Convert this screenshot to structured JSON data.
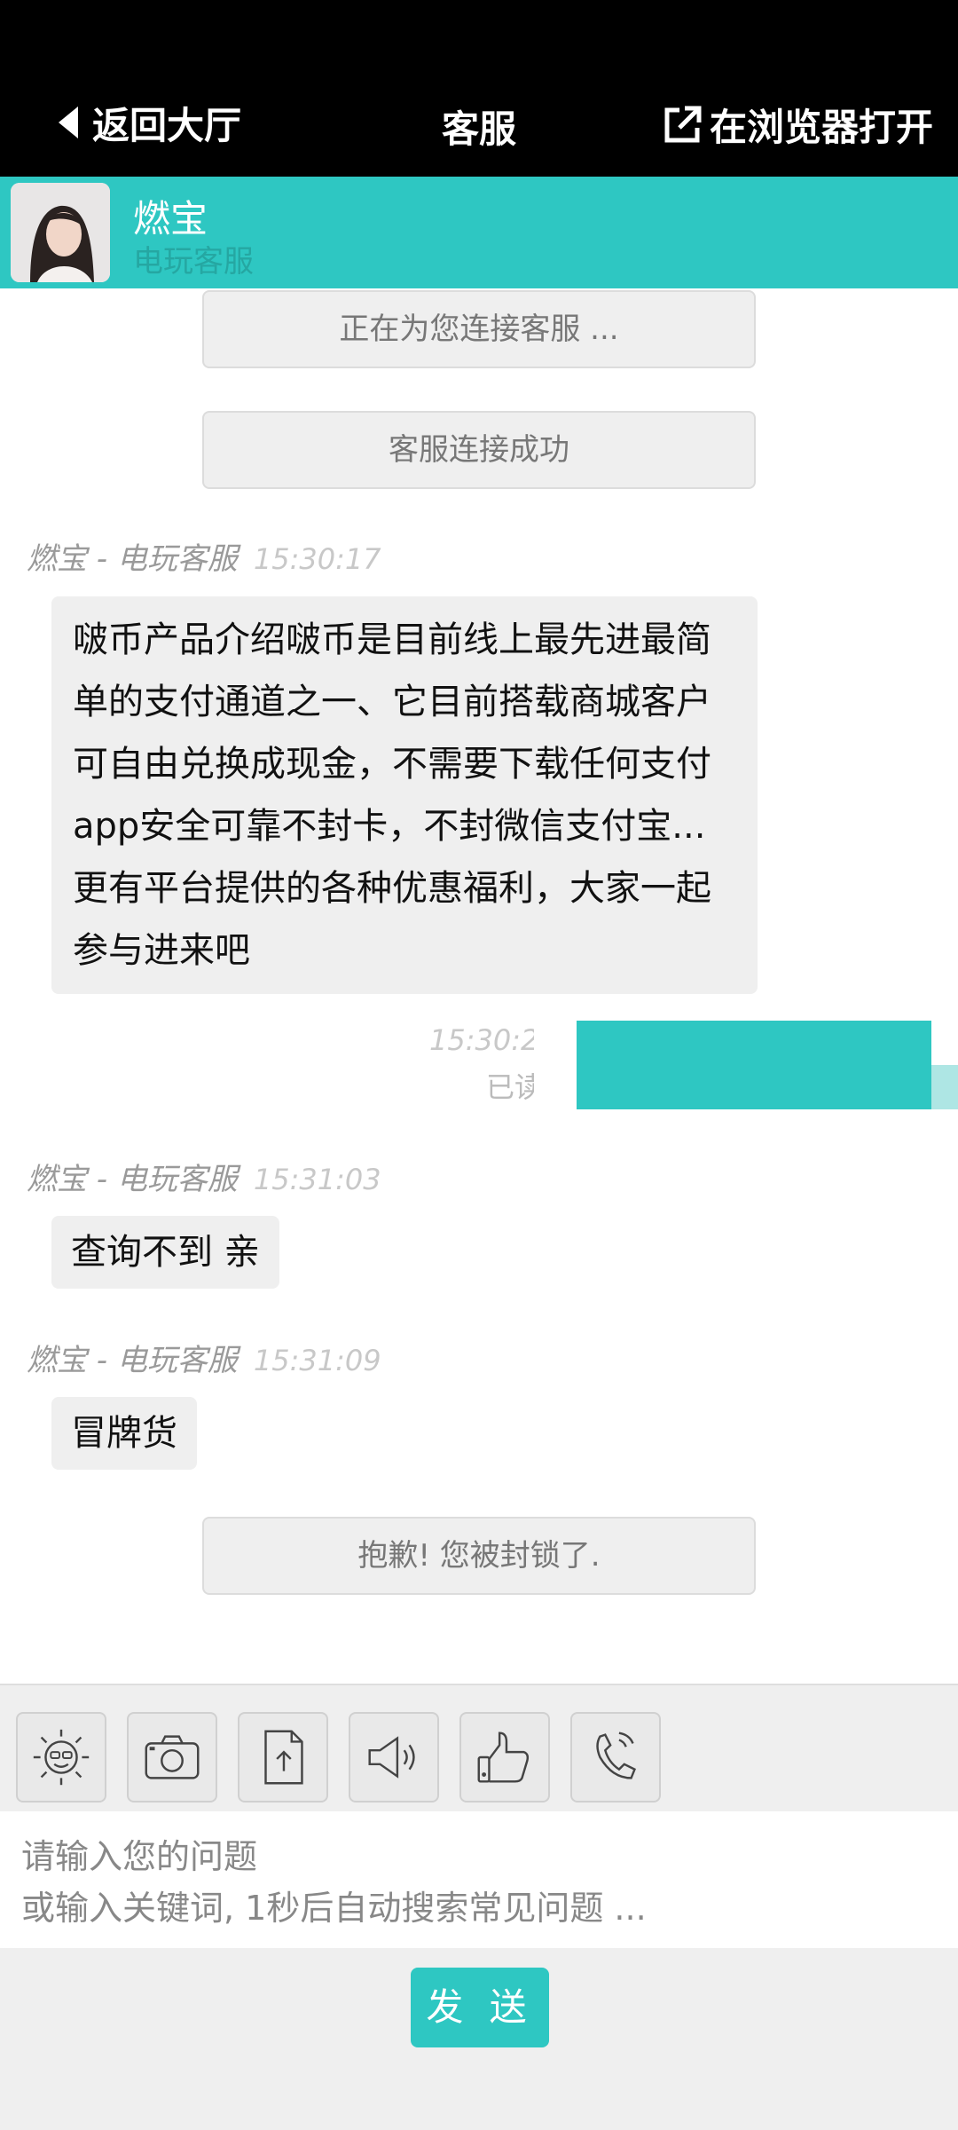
{
  "header": {
    "back_label": "返回大厅",
    "title": "客服",
    "open_browser_label": "在浏览器打开"
  },
  "agent": {
    "name": "燃宝",
    "role": "电玩客服"
  },
  "messages": {
    "system_connecting": "正在为您连接客服 ...",
    "system_connected": "客服连接成功",
    "msg1": {
      "sender": "燃宝 - 电玩客服",
      "time": "15:30:17",
      "text": "啵币产品介绍啵币是目前线上最先进最简单的支付通道之一、它目前搭载商城客户可自由兑换成现金，不需要下载任何支付app安全可靠不封卡，不封微信支付宝...更有平台提供的各种优惠福利，大家一起参与进来吧"
    },
    "outgoing": {
      "time": "15:30:2",
      "status": "已读"
    },
    "msg2": {
      "sender": "燃宝 - 电玩客服",
      "time": "15:31:03",
      "text": "查询不到 亲"
    },
    "msg3": {
      "sender": "燃宝 - 电玩客服",
      "time": "15:31:09",
      "text": "冒牌货"
    },
    "system_blocked": "抱歉! 您被封锁了."
  },
  "toolbar": {
    "icons": [
      "emoji-icon",
      "camera-icon",
      "upload-icon",
      "megaphone-icon",
      "thumbs-up-icon",
      "phone-icon"
    ]
  },
  "input": {
    "placeholder": "请输入您的问题\n或输入关键词, 1秒后自动搜索常见问题 ..."
  },
  "send_label": "发 送",
  "colors": {
    "accent": "#2ec7c2",
    "header_bg": "#000000",
    "bubble_bg": "#efefef"
  }
}
